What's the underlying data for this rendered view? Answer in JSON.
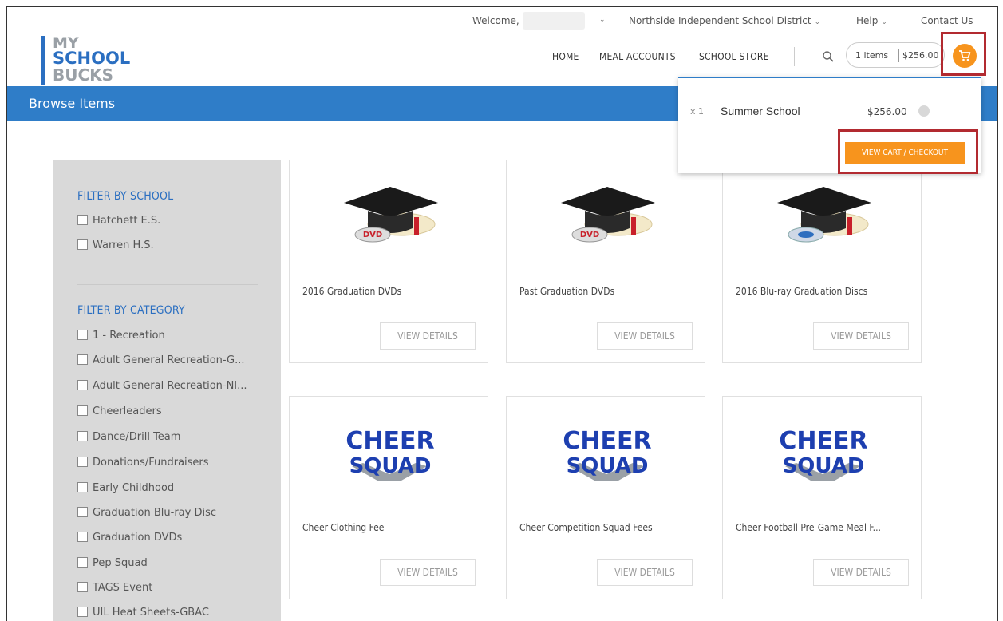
{
  "utility": {
    "welcome": "Welcome,",
    "district": "Northside Independent School District",
    "help": "Help",
    "contact": "Contact Us"
  },
  "logo": {
    "line1": "MY",
    "line2": "SCHOOL",
    "line3": "BUCKS"
  },
  "nav": {
    "home": "HOME",
    "meal_accounts": "MEAL ACCOUNTS",
    "school_store": "SCHOOL STORE"
  },
  "cart": {
    "items": "1 items",
    "total": "$256.00"
  },
  "page": {
    "title": "Browse Items"
  },
  "filters": {
    "school_title": "FILTER BY SCHOOL",
    "schools": [
      "Hatchett E.S.",
      "Warren H.S."
    ],
    "category_title": "FILTER BY CATEGORY",
    "categories": [
      "1 - Recreation",
      "Adult General Recreation-G...",
      "Adult General Recreation-NI...",
      "Cheerleaders",
      "Dance/Drill Team",
      "Donations/Fundraisers",
      "Early Childhood",
      "Graduation Blu-ray Disc",
      "Graduation DVDs",
      "Pep Squad",
      "TAGS Event",
      "UIL Heat Sheets-GBAC"
    ]
  },
  "products": [
    {
      "name": "2016 Graduation DVDs",
      "button": "VIEW DETAILS",
      "image": "graduation-cap-dvd",
      "disc_label": "DVD"
    },
    {
      "name": "Past Graduation DVDs",
      "button": "VIEW DETAILS",
      "image": "graduation-cap-dvd",
      "disc_label": "DVD"
    },
    {
      "name": "2016 Blu-ray Graduation Discs",
      "button": "VIEW DETAILS",
      "image": "graduation-cap-bluray"
    },
    {
      "name": "Cheer-Clothing Fee",
      "button": "VIEW DETAILS",
      "image": "cheer-squad-logo",
      "logo_text_1": "CHEER",
      "logo_text_2": "SQUAD"
    },
    {
      "name": "Cheer-Competition Squad Fees",
      "button": "VIEW DETAILS",
      "image": "cheer-squad-logo",
      "logo_text_1": "CHEER",
      "logo_text_2": "SQUAD"
    },
    {
      "name": "Cheer-Football Pre-Game Meal F...",
      "button": "VIEW DETAILS",
      "image": "cheer-squad-logo",
      "logo_text_1": "CHEER",
      "logo_text_2": "SQUAD"
    }
  ],
  "dropdown": {
    "qty": "x 1",
    "item_name": "Summer School",
    "item_price": "$256.00",
    "checkout": "VIEW CART / CHECKOUT"
  },
  "colors": {
    "brand_blue": "#2f7dc8",
    "accent_orange": "#f7941d",
    "highlight_red": "#b22a30"
  }
}
